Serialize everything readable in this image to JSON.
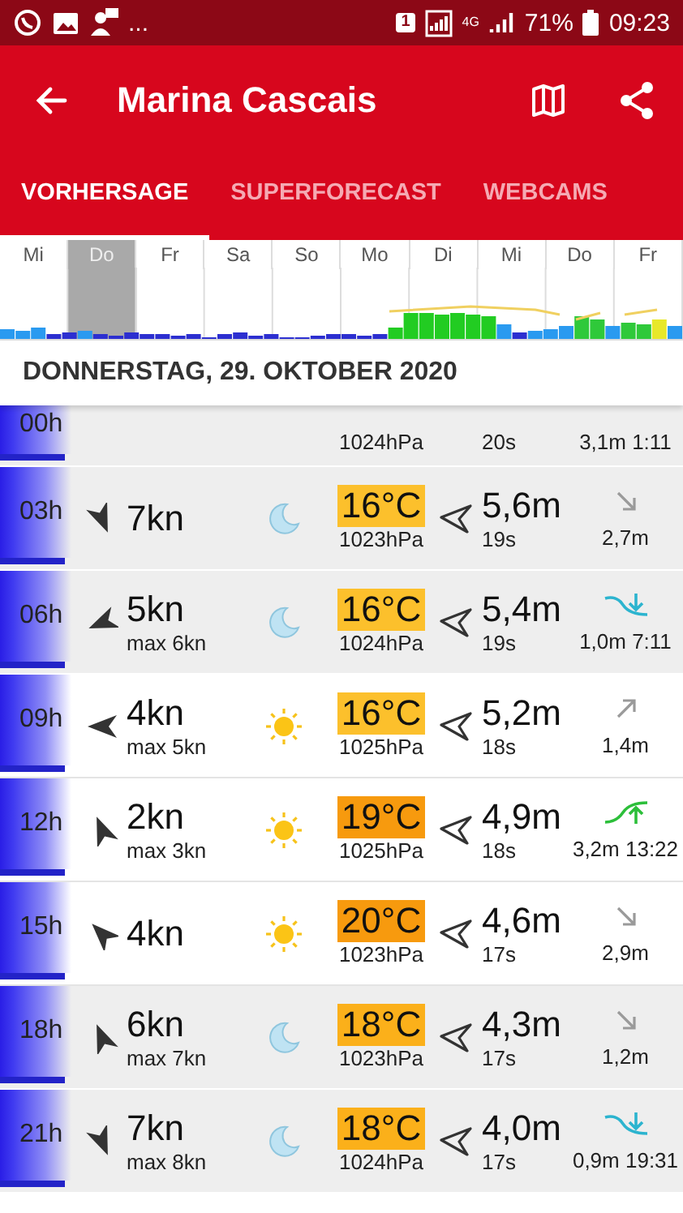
{
  "status_bar": {
    "more": "...",
    "sim": "1",
    "network": "4G",
    "battery": "71%",
    "time": "09:23"
  },
  "app_bar": {
    "title": "Marina Cascais"
  },
  "tabs": [
    {
      "label": "VORHERSAGE",
      "selected": true
    },
    {
      "label": "SUPERFORECAST",
      "selected": false
    },
    {
      "label": "WEBCAMS",
      "selected": false
    }
  ],
  "days": [
    {
      "label": "Mi",
      "selected": false
    },
    {
      "label": "Do",
      "selected": true
    },
    {
      "label": "Fr",
      "selected": false
    },
    {
      "label": "Sa",
      "selected": false
    },
    {
      "label": "So",
      "selected": false
    },
    {
      "label": "Mo",
      "selected": false
    },
    {
      "label": "Di",
      "selected": false
    },
    {
      "label": "Mi",
      "selected": false
    },
    {
      "label": "Do",
      "selected": false
    },
    {
      "label": "Fr",
      "selected": false
    }
  ],
  "date_header": "DONNERSTAG, 29. OKTOBER 2020",
  "rows": [
    {
      "hour": "00h",
      "cut_off": true,
      "pressure": "1024hPa",
      "period": "20s",
      "tide": {
        "text": "3,1m 1:11"
      }
    },
    {
      "hour": "03h",
      "cut_off": false,
      "wind": "7kn",
      "wind_arrow": {
        "kind": "sse"
      },
      "weather_icon": {
        "kind": "moon"
      },
      "temp": "16°C",
      "color": "#fcc02c",
      "pressure": "1023hPa",
      "swell": "5,6m",
      "period": "19s",
      "tide": {
        "kind": "down",
        "text": "2,7m"
      }
    },
    {
      "hour": "06h",
      "cut_off": false,
      "wind": "5kn",
      "gust": "max 6kn",
      "wind_arrow": {
        "kind": "wsw"
      },
      "weather_icon": {
        "kind": "moon"
      },
      "temp": "16°C",
      "color": "#fcc02c",
      "pressure": "1024hPa",
      "swell": "5,4m",
      "period": "19s",
      "tide": {
        "kind": "falling",
        "text": "1,0m 7:11"
      }
    },
    {
      "hour": "09h",
      "cut_off": false,
      "wind": "4kn",
      "gust": "max 5kn",
      "wind_arrow": {
        "kind": "w"
      },
      "weather_icon": {
        "kind": "sun"
      },
      "temp": "16°C",
      "color": "#fcc02c",
      "pressure": "1025hPa",
      "swell": "5,2m",
      "period": "18s",
      "tide": {
        "kind": "up",
        "text": "1,4m"
      }
    },
    {
      "hour": "12h",
      "cut_off": false,
      "wind": "2kn",
      "gust": "max 3kn",
      "wind_arrow": {
        "kind": "nnw"
      },
      "weather_icon": {
        "kind": "sun"
      },
      "temp": "19°C",
      "color": "#f79a0e",
      "pressure": "1025hPa",
      "swell": "4,9m",
      "period": "18s",
      "tide": {
        "kind": "rising",
        "text": "3,2m 13:22"
      }
    },
    {
      "hour": "15h",
      "cut_off": false,
      "wind": "4kn",
      "wind_arrow": {
        "kind": "nw"
      },
      "weather_icon": {
        "kind": "sun"
      },
      "temp": "20°C",
      "color": "#f79a0e",
      "pressure": "1023hPa",
      "swell": "4,6m",
      "period": "17s",
      "tide": {
        "kind": "down",
        "text": "2,9m"
      }
    },
    {
      "hour": "18h",
      "cut_off": false,
      "wind": "6kn",
      "gust": "max 7kn",
      "wind_arrow": {
        "kind": "nnw"
      },
      "weather_icon": {
        "kind": "moon"
      },
      "temp": "18°C",
      "color": "#fbb01a",
      "pressure": "1023hPa",
      "swell": "4,3m",
      "period": "17s",
      "tide": {
        "kind": "down",
        "text": "1,2m"
      }
    },
    {
      "hour": "21h",
      "cut_off": false,
      "wind": "7kn",
      "gust": "max 8kn",
      "wind_arrow": {
        "kind": "sse"
      },
      "weather_icon": {
        "kind": "moon"
      },
      "temp": "18°C",
      "color": "#fbb01a",
      "pressure": "1024hPa",
      "swell": "4,0m",
      "period": "17s",
      "tide": {
        "kind": "falling",
        "text": "0,9m 19:31"
      }
    }
  ]
}
